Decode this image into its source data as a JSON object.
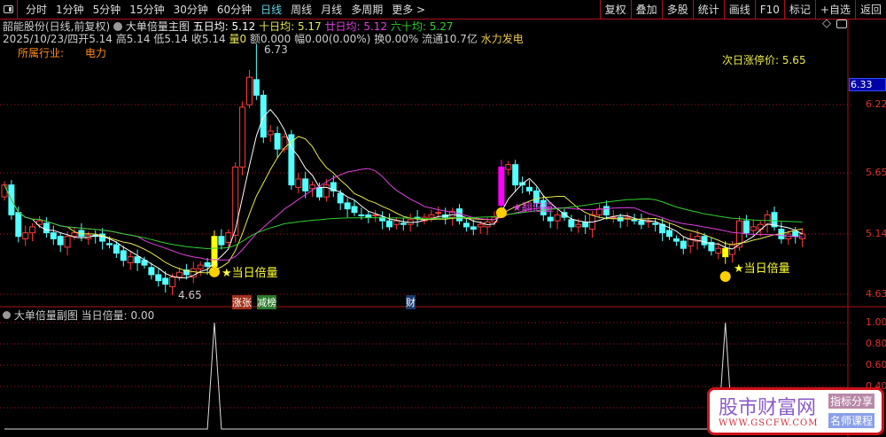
{
  "topbar": {
    "periods": [
      "分时",
      "1分钟",
      "5分钟",
      "15分钟",
      "30分钟",
      "60分钟",
      "日线",
      "周线",
      "月线",
      "多周期",
      "更多 >"
    ],
    "active": "日线",
    "tools": [
      "复权",
      "叠加",
      "多股",
      "统计",
      "画线",
      "F10",
      "标记",
      "+自选",
      "返回"
    ]
  },
  "header": {
    "stock": "韶能股份(日线,前复权)",
    "indicator": "大单倍量主图",
    "ma5": "五日均: 5.12",
    "ma10": "十日均: 5.17",
    "ma20": "廿日均: 5.12",
    "ma60": "六十均: 5.27"
  },
  "quote": {
    "date": "2025/10/23/四",
    "open": "开5.14",
    "high": "高5.14",
    "low": "低5.14",
    "close": "收5.14",
    "vol_label": "量",
    "vol": "0",
    "amount": "额0.000",
    "range": "幅0.00(0.00%)",
    "turnover": "换0.00%",
    "float": "流通10.7亿",
    "concept": "水力发电"
  },
  "industry": {
    "label": "所属行业:",
    "value": "电力"
  },
  "limit_next": "次日涨停价: 5.65",
  "annotations": {
    "high": "6.73",
    "low": "4.65",
    "signal": "★当日倍量",
    "signal2": "★翻倍量",
    "tag1": "涨张",
    "tag2": "减榜",
    "tag3": "财"
  },
  "axis": {
    "current": "6.33",
    "ticks": [
      "6.22",
      "5.65",
      "5.14",
      "4.63"
    ],
    "sub_ticks": [
      "1.00",
      "0.80",
      "0.60",
      "0.40"
    ]
  },
  "sub": {
    "title": "大单倍量副图",
    "value": "当日倍量: 0.00"
  },
  "watermark": {
    "name": "股市财富网",
    "url": "WWW.GSCFW.COM",
    "b1": "指标分享",
    "b2": "名师课程"
  },
  "colors": {
    "up": "#ff3c3c",
    "down": "#54ffff",
    "ma5": "#ffffff",
    "ma10": "#e8e84c",
    "ma20": "#e040e0",
    "ma60": "#30d030",
    "grid": "#b0101a"
  },
  "chart_data": {
    "type": "candlestick",
    "price_range": [
      4.55,
      6.85
    ],
    "closes": [
      5.55,
      5.3,
      5.12,
      5.15,
      5.2,
      5.25,
      5.15,
      5.1,
      5.05,
      5.12,
      5.15,
      5.12,
      5.13,
      5.12,
      5.08,
      5.05,
      4.98,
      4.92,
      4.95,
      4.9,
      4.88,
      4.8,
      4.75,
      4.72,
      4.78,
      4.82,
      4.8,
      4.85,
      4.88,
      4.87,
      5.12,
      5.05,
      5.15,
      5.7,
      6.2,
      6.45,
      6.3,
      5.95,
      6.0,
      5.85,
      5.95,
      5.55,
      5.6,
      5.5,
      5.55,
      5.45,
      5.55,
      5.5,
      5.4,
      5.35,
      5.32,
      5.3,
      5.28,
      5.3,
      5.25,
      5.2,
      5.25,
      5.22,
      5.26,
      5.27,
      5.28,
      5.3,
      5.32,
      5.28,
      5.33,
      5.25,
      5.2,
      5.18,
      5.22,
      5.24,
      5.28,
      5.7,
      5.72,
      5.55,
      5.55,
      5.5,
      5.4,
      5.3,
      5.25,
      5.3,
      5.28,
      5.2,
      5.22,
      5.2,
      5.3,
      5.35,
      5.3,
      5.28,
      5.25,
      5.28,
      5.25,
      5.22,
      5.25,
      5.22,
      5.15,
      5.12,
      5.08,
      5.02,
      5.1,
      5.12,
      5.05,
      5.0,
      5.02,
      4.95,
      5.05,
      5.25,
      5.15,
      5.2,
      5.22,
      5.3,
      5.2,
      5.1,
      5.14,
      5.12,
      5.14
    ],
    "yellow_idx": [
      30,
      103
    ],
    "magenta_idx": [
      71
    ],
    "high_idx": 36,
    "low_idx": 23,
    "sub_values_spikes": [
      30,
      103
    ],
    "sub_range": [
      0,
      1
    ]
  }
}
